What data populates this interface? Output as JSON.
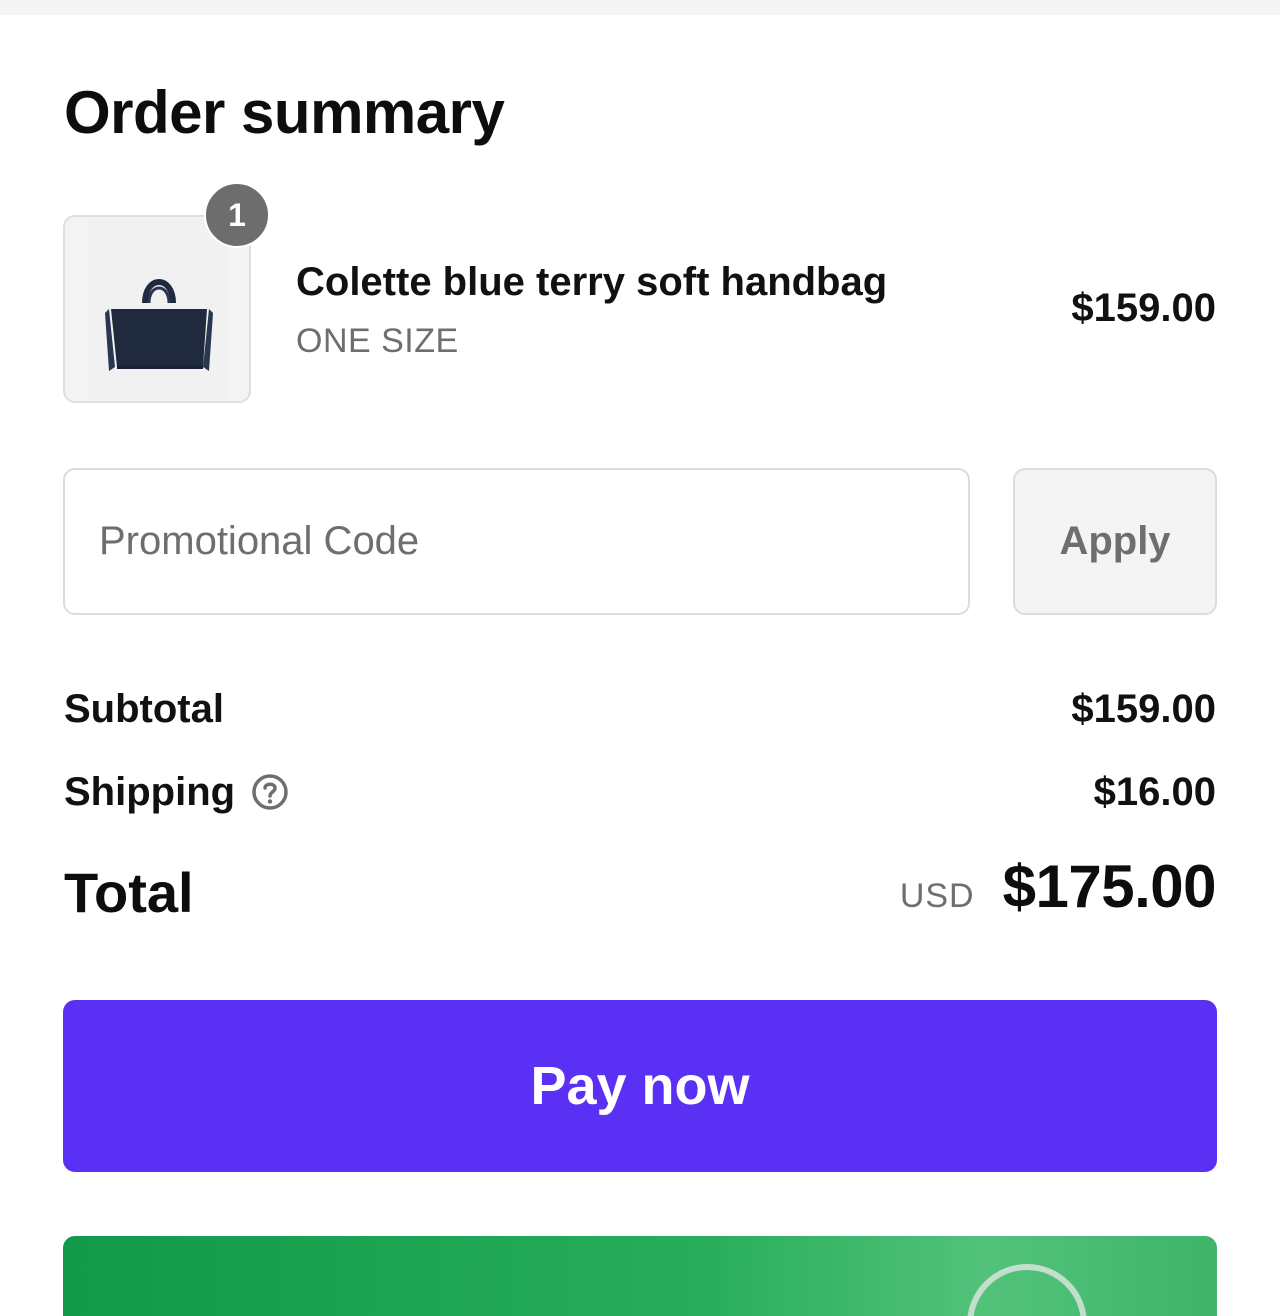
{
  "page": {
    "title": "Order summary"
  },
  "cart": {
    "items": [
      {
        "name": "Colette blue terry soft handbag",
        "variant": "ONE SIZE",
        "price": "$159.00",
        "quantity": "1",
        "image_icon": "handbag-image"
      }
    ]
  },
  "promo": {
    "placeholder": "Promotional Code",
    "value": "",
    "apply_label": "Apply"
  },
  "summary": {
    "subtotal_label": "Subtotal",
    "subtotal_value": "$159.00",
    "shipping_label": "Shipping",
    "shipping_help_icon": "question-circle-icon",
    "shipping_value": "$16.00",
    "total_label": "Total",
    "currency": "USD",
    "total_value": "$175.00"
  },
  "actions": {
    "pay_label": "Pay now"
  },
  "colors": {
    "pay_button": "#5a31f4",
    "badge": "#6d6d6d",
    "muted_text": "#6e6e6e",
    "banner_green": "#119a4a"
  }
}
